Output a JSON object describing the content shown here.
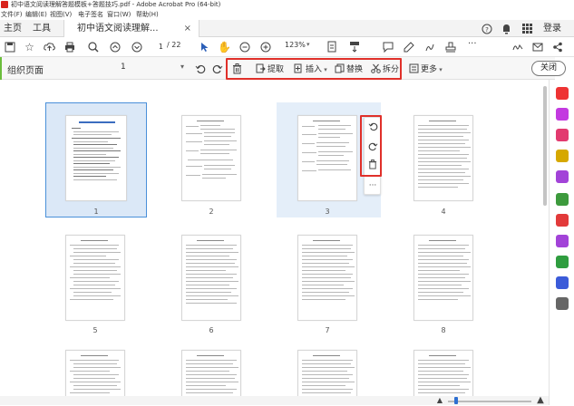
{
  "window": {
    "title": "初中语文阅读理解答题模板+答题技巧.pdf - Adobe Acrobat Pro (64-bit)"
  },
  "menu": [
    "文件(F)",
    "编辑(E)",
    "视图(V)",
    "电子签名",
    "窗口(W)",
    "帮助(H)"
  ],
  "tabs": {
    "home": "主页",
    "tools": "工具",
    "doc": "初中语文阅读理解...",
    "close": "×",
    "login": "登录"
  },
  "toolbar": {
    "page_current": "1",
    "page_total": "/ 22",
    "zoom": "123%",
    "more": "···"
  },
  "organize": {
    "title": "组织页面",
    "page_select": "1",
    "extract": "提取",
    "insert": "插入",
    "replace": "替换",
    "split": "拆分",
    "more": "更多",
    "close": "关闭"
  },
  "pages": [
    {
      "num": "1"
    },
    {
      "num": "2"
    },
    {
      "num": "3"
    },
    {
      "num": "4"
    },
    {
      "num": "5"
    },
    {
      "num": "6"
    },
    {
      "num": "7"
    },
    {
      "num": "8"
    },
    {
      "num": ""
    },
    {
      "num": ""
    },
    {
      "num": ""
    },
    {
      "num": ""
    }
  ],
  "colors": {
    "accent_red": "#e0302a",
    "selection_blue": "#4a90d9",
    "organize_green": "#6bbd3c"
  },
  "icons": {
    "right_rail": [
      "export-pdf-icon",
      "edit-pdf-icon",
      "create-pdf-icon",
      "comment-icon",
      "fill-sign-icon",
      "organize-pages-icon",
      "redact-icon",
      "protect-icon",
      "print-production-icon",
      "more-tools-icon"
    ]
  }
}
